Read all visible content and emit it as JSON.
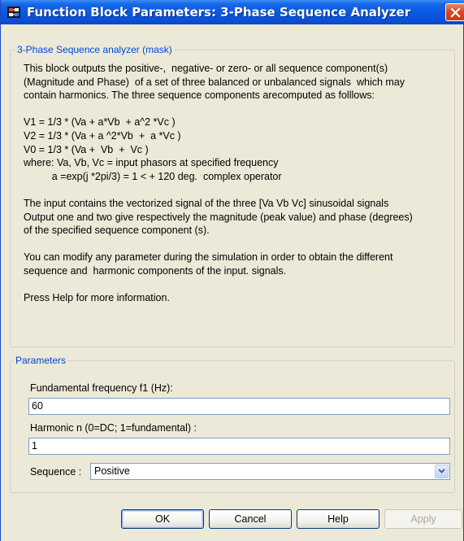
{
  "window": {
    "title": "Function Block Parameters: 3-Phase Sequence Analyzer"
  },
  "description_group": {
    "legend": "3-Phase Sequence analyzer (mask)",
    "lines": [
      "This block outputs the positive-,  negative- or zero- or all sequence component(s)",
      "(Magnitude and Phase)  of a set of three balanced or unbalanced signals  which may",
      "contain harmonics. The three sequence components arecomputed as folllows:",
      "",
      "V1 = 1/3 * (Va + a*Vb  + a^2 *Vc )",
      "V2 = 1/3 * (Va + a ^2*Vb  +  a *Vc )",
      "V0 = 1/3 * (Va +  Vb  +  Vc )",
      "where: Va, Vb, Vc = input phasors at specified frequency",
      "          a =exp(j *2pi/3) = 1 < + 120 deg.  complex operator",
      "",
      "The input contains the vectorized signal of the three [Va Vb Vc] sinusoidal signals",
      "Output one and two give respectively the magnitude (peak value) and phase (degrees)",
      "of the specified sequence component (s).",
      "",
      "You can modify any parameter during the simulation in order to obtain the different",
      "sequence and  harmonic components of the input. signals.",
      "",
      "Press Help for more information."
    ]
  },
  "parameters": {
    "legend": "Parameters",
    "frequency": {
      "label": "Fundamental frequency f1 (Hz):",
      "value": "60"
    },
    "harmonic": {
      "label": "Harmonic n (0=DC; 1=fundamental) :",
      "value": "1"
    },
    "sequence": {
      "label": "Sequence :",
      "value": "Positive"
    }
  },
  "buttons": {
    "ok": "OK",
    "cancel": "Cancel",
    "help": "Help",
    "apply": "Apply"
  },
  "colors": {
    "titlebar": "#0a58e0",
    "legend_text": "#0046d5",
    "window_bg": "#ece9d8",
    "close_button": "#d9472b"
  }
}
